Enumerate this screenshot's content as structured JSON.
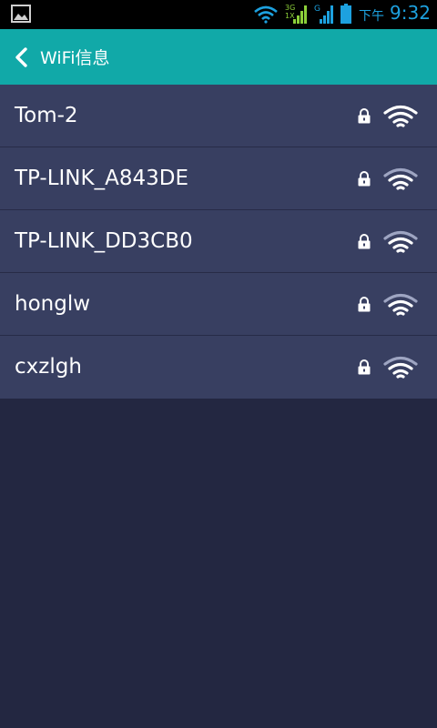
{
  "status_bar": {
    "ampm": "下午",
    "time": "9:32",
    "network_3g_label": "3G",
    "network_1x_label": "1X",
    "network_g_label": "G",
    "icons": [
      "gallery-icon",
      "wifi-icon",
      "cell-signal-3g-icon",
      "cell-signal-g-icon",
      "battery-icon"
    ],
    "accent_color": "#1da1df"
  },
  "header": {
    "title": "WiFi信息",
    "back_icon": "chevron-left-icon",
    "background_color": "#11a9a8"
  },
  "networks": [
    {
      "ssid": "Tom-2",
      "secured": true,
      "signal": "strong"
    },
    {
      "ssid": "TP-LINK_A843DE",
      "secured": true,
      "signal": "medium"
    },
    {
      "ssid": "TP-LINK_DD3CB0",
      "secured": true,
      "signal": "medium"
    },
    {
      "ssid": "honglw",
      "secured": true,
      "signal": "medium"
    },
    {
      "ssid": "cxzlgh",
      "secured": true,
      "signal": "medium"
    }
  ],
  "colors": {
    "list_background": "#383f61",
    "page_background": "#232741"
  }
}
